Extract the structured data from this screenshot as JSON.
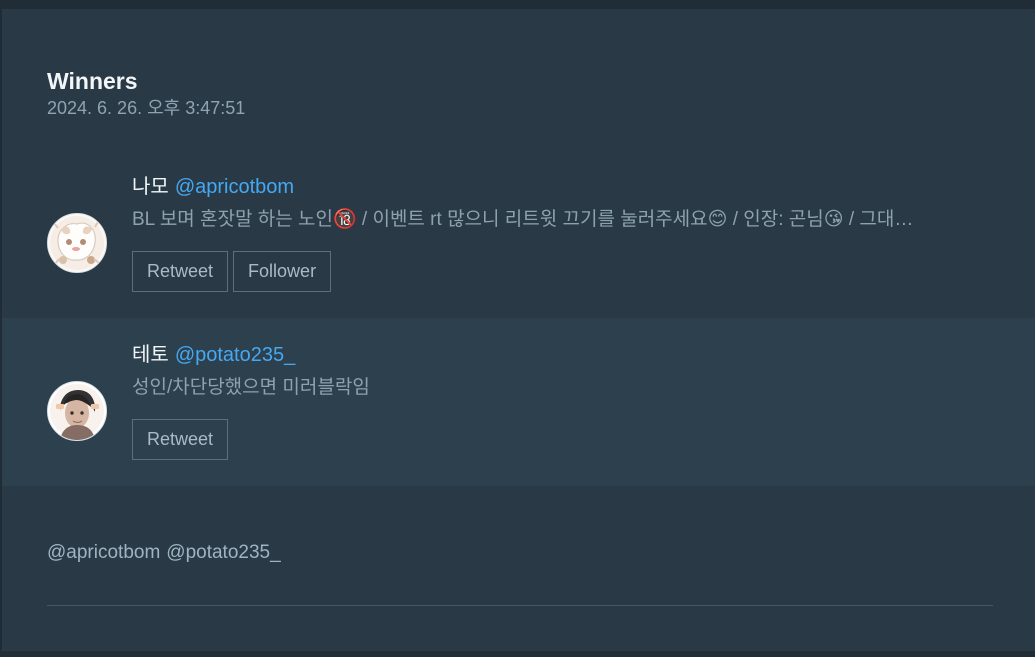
{
  "panel": {
    "title": "Winners",
    "timestamp": "2024. 6. 26. 오후 3:47:51"
  },
  "winners": [
    {
      "name": "나모",
      "handle": "@apricotbom",
      "bio": "BL 보며 혼잣말 하는 노인🔞 / 이벤트 rt 많으니 리트윗 끄기를 눌러주세요😊 / 인장: 곤님😘 / 그대…",
      "buttons": [
        "Retweet",
        "Follower"
      ],
      "avatar_icon": "profile-avatar-cute-illustration"
    },
    {
      "name": "테토",
      "handle": "@potato235_",
      "bio": "성인/차단당했으면 미러블락임",
      "buttons": [
        "Retweet"
      ],
      "avatar_icon": "profile-avatar-portrait-illustration"
    }
  ],
  "mentions": [
    "@apricotbom",
    "@potato235_"
  ],
  "colors": {
    "background": "#212d36",
    "panel": "#293a46",
    "highlight_row": "#2d404d",
    "handle": "#46a8f1",
    "muted_text": "#8ea1af"
  }
}
